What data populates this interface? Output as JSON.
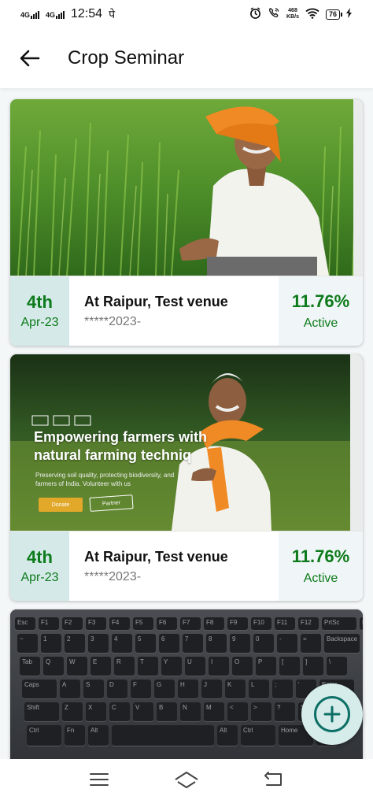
{
  "status_bar": {
    "net1": "4G",
    "net2": "4G",
    "time": "12:54",
    "extra_glyph": "पे",
    "speed_value": "468",
    "speed_unit": "KB/s",
    "battery": "76"
  },
  "app_bar": {
    "title": "Crop Seminar",
    "back_icon": "arrow-left-icon"
  },
  "banner2_overlay": {
    "headline_line1": "Empowering farmers with",
    "headline_line2": "natural farming techniq",
    "subtext_line1": "Preserving soil quality, protecting biodiversity, and",
    "subtext_line2": "farmers of India. Volunteer with us",
    "donate": "Donate",
    "partner": "Partner"
  },
  "keyboard": {
    "row1": [
      "Esc",
      "F1",
      "F2",
      "F3",
      "F4",
      "F5",
      "F6",
      "F7",
      "F8",
      "F9",
      "F10",
      "F11",
      "F12",
      "PrtSc",
      "Insert",
      "Delete"
    ],
    "row2": [
      "~",
      "1",
      "2",
      "3",
      "4",
      "5",
      "6",
      "7",
      "8",
      "9",
      "0",
      "-",
      "=",
      "Backspace"
    ],
    "row3": [
      "Tab",
      "Q",
      "W",
      "E",
      "R",
      "T",
      "Y",
      "U",
      "I",
      "O",
      "P",
      "[",
      "]",
      "\\"
    ],
    "row4": [
      "Caps",
      "A",
      "S",
      "D",
      "F",
      "G",
      "H",
      "J",
      "K",
      "L",
      ";",
      "'",
      "Enter"
    ],
    "row5": [
      "Shift",
      "Z",
      "X",
      "C",
      "V",
      "B",
      "N",
      "M",
      "<",
      ">",
      "?",
      "Shift"
    ],
    "row6": [
      "Ctrl",
      "Fn",
      "Alt",
      "",
      "Alt",
      "Ctrl",
      "Home",
      "End"
    ]
  },
  "seminars": [
    {
      "day": "4th",
      "month": "Apr-23",
      "venue": "At Raipur, Test venue",
      "code": "*****2023-",
      "percent": "11.76%",
      "status": "Active"
    },
    {
      "day": "4th",
      "month": "Apr-23",
      "venue": "At Raipur, Test venue",
      "code": "*****2023-",
      "percent": "11.76%",
      "status": "Active"
    }
  ],
  "fab": {
    "icon": "plus-icon"
  },
  "nav": {
    "menu_icon": "menu-icon",
    "home_icon": "home-icon",
    "back_icon": "back-icon"
  },
  "colors": {
    "accent_green": "#0d7a1b",
    "date_bg": "#d5eae8",
    "fab_teal": "#0d6f66"
  }
}
